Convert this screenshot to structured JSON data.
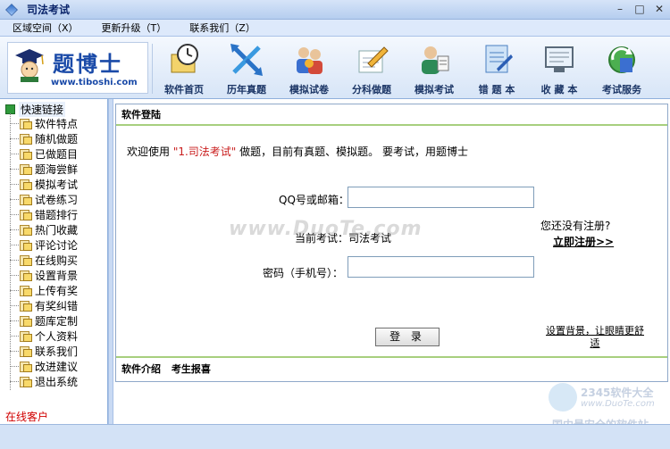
{
  "window": {
    "title": "司法考试"
  },
  "menu": [
    "区域空间（X）",
    "更新升级（T）",
    "联系我们（Z）"
  ],
  "logo": {
    "brand": "题博士",
    "url": "www.tiboshi.com"
  },
  "toolbar": [
    {
      "label": "软件首页",
      "icon": "home-clock-icon"
    },
    {
      "label": "历年真题",
      "icon": "arrows-icon"
    },
    {
      "label": "模拟试卷",
      "icon": "people-icon"
    },
    {
      "label": "分科做题",
      "icon": "pencil-paper-icon"
    },
    {
      "label": "模拟考试",
      "icon": "examinee-icon"
    },
    {
      "label": "错 题 本",
      "icon": "notebook-icon"
    },
    {
      "label": "收 藏 本",
      "icon": "monitor-icon"
    },
    {
      "label": "考试服务",
      "icon": "refresh-globe-icon"
    }
  ],
  "sidebar": {
    "root": "快速链接",
    "items": [
      "软件特点",
      "随机做题",
      "已做题目",
      "题海尝鲜",
      "模拟考试",
      "试卷练习",
      "错题排行",
      "热门收藏",
      "评论讨论",
      "在线购买",
      "设置背景",
      "上传有奖",
      "有奖纠错",
      "题库定制",
      "个人资料",
      "联系我们",
      "改进建议",
      "退出系统"
    ],
    "online": "在线客户"
  },
  "main": {
    "header": "软件登陆",
    "welcome": {
      "pre": "欢迎使用 ",
      "highlight": "\"1.司法考试\"",
      "post": " 做题，目前有真题、模拟题。 要考试，用题博士"
    },
    "user_label": "QQ号或邮箱：",
    "user_value": "",
    "current_exam": "当前考试：司法考试",
    "password_label": "密码（手机号）：",
    "password_value": "",
    "register_question": "您还没有注册?",
    "register_link": "立即注册>>",
    "login_button": "登 录",
    "background_link": "设置背景，让眼睛更舒适",
    "footer": [
      "软件介绍",
      "考生报喜"
    ]
  },
  "watermarks": {
    "center": "www.DuoTe.com",
    "corner_title": "2345软件大全",
    "corner_url": "www.DuoTe.com",
    "corner_slogan": "国内最安全的软件站"
  }
}
